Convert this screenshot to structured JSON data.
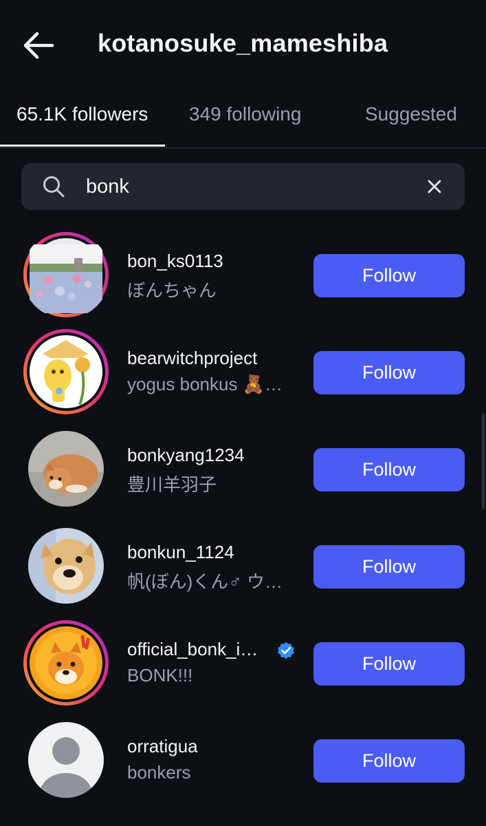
{
  "header": {
    "title": "kotanosuke_mameshiba",
    "back_icon": "arrow-left-icon"
  },
  "tabs": [
    {
      "label": "65.1K followers",
      "active": true
    },
    {
      "label": "349 following",
      "active": false
    },
    {
      "label": "Suggested",
      "active": false
    }
  ],
  "search": {
    "value": "bonk",
    "icon": "search-icon",
    "clear_icon": "close-icon"
  },
  "colors": {
    "background": "#0c0f14",
    "accent": "#4a5cf3",
    "muted_text": "#9aa0a8",
    "story_ring": "#d9258a"
  },
  "users": [
    {
      "username": "bon_ks0113",
      "subtitle": "ぼんちゃん",
      "button": "Follow",
      "verified": false,
      "story_ring": true
    },
    {
      "username": "bearwitchproject",
      "subtitle": "yogus bonkus 🧸…",
      "button": "Follow",
      "verified": false,
      "story_ring": true
    },
    {
      "username": "bonkyang1234",
      "subtitle": "豊川羊羽子",
      "button": "Follow",
      "verified": false,
      "story_ring": false
    },
    {
      "username": "bonkun_1124",
      "subtitle": "帆(ぼん)くん♂ ウ…",
      "button": "Follow",
      "verified": false,
      "story_ring": false
    },
    {
      "username": "official_bonk_i…",
      "subtitle": "BONK!!!",
      "button": "Follow",
      "verified": true,
      "story_ring": true
    },
    {
      "username": "orratigua",
      "subtitle": "bonkers",
      "button": "Follow",
      "verified": false,
      "story_ring": false
    }
  ]
}
